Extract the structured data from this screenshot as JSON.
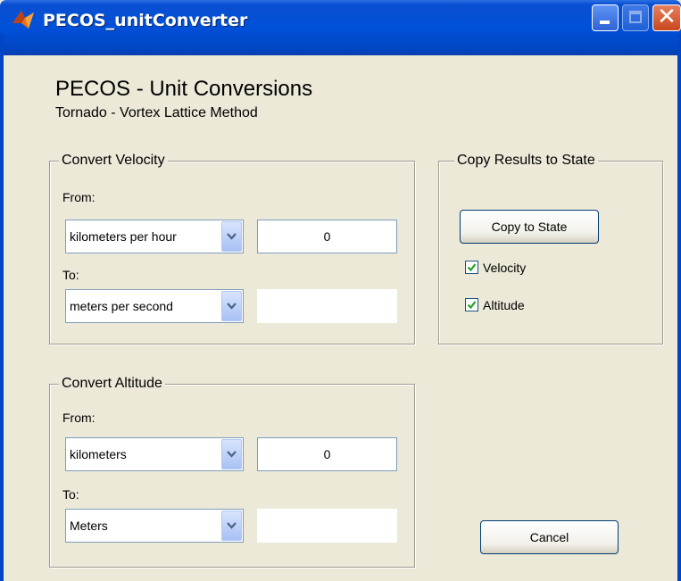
{
  "window": {
    "title": "PECOS_unitConverter",
    "icon": "matlab-icon"
  },
  "header": {
    "title": "PECOS - Unit Conversions",
    "subtitle": "Tornado - Vortex Lattice Method"
  },
  "velocity": {
    "legend": "Convert Velocity",
    "from_label": "From:",
    "from_unit": "kilometers per hour",
    "from_value": "0",
    "to_label": "To:",
    "to_unit": "meters per second",
    "to_value": ""
  },
  "altitude": {
    "legend": "Convert Altitude",
    "from_label": "From:",
    "from_unit": "kilometers",
    "from_value": "0",
    "to_label": "To:",
    "to_unit": "Meters",
    "to_value": ""
  },
  "copy": {
    "legend": "Copy Results to State",
    "button_label": "Copy to State",
    "velocity_label": "Velocity",
    "velocity_checked": true,
    "altitude_label": "Altitude",
    "altitude_checked": true
  },
  "actions": {
    "cancel_label": "Cancel"
  },
  "colors": {
    "titlebar": "#0050d8",
    "background": "#ece9d8",
    "close": "#c8471e"
  }
}
